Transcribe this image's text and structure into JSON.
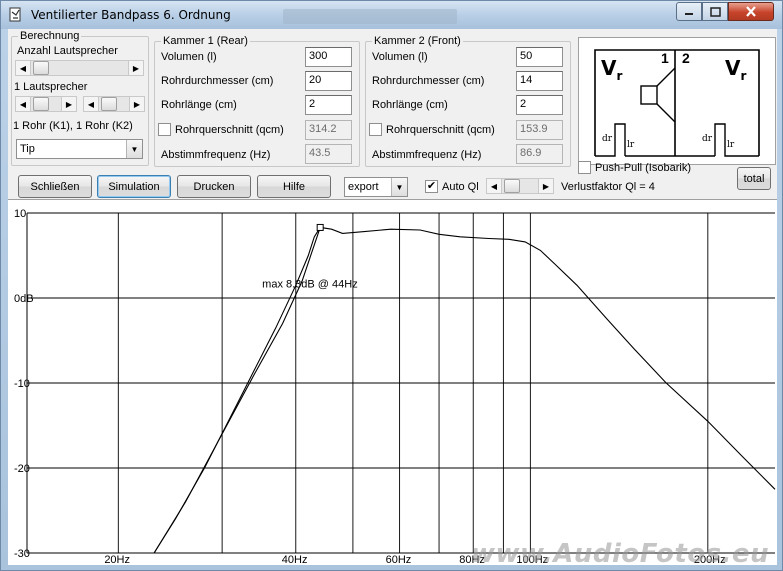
{
  "window": {
    "title": "Ventilierter Bandpass 6. Ordnung"
  },
  "berechnung": {
    "legend": "Berechnung",
    "anzahl_label": "Anzahl Lautsprecher",
    "lautsprecher_label": "1 Lautsprecher",
    "rohr_label": "1 Rohr (K1), 1 Rohr (K2)",
    "tip_value": "Tip"
  },
  "kammer1": {
    "legend": "Kammer 1 (Rear)",
    "volumen_label": "Volumen (l)",
    "volumen_value": "300",
    "rohrdurchmesser_label": "Rohrdurchmesser (cm)",
    "rohrdurchmesser_value": "20",
    "rohrlaenge_label": "Rohrlänge (cm)",
    "rohrlaenge_value": "2",
    "rohrquerschnitt_label": "Rohrquerschnitt (qcm)",
    "rohrquerschnitt_value": "314.2",
    "abstimm_label": "Abstimmfrequenz (Hz)",
    "abstimm_value": "43.5"
  },
  "kammer2": {
    "legend": "Kammer 2 (Front)",
    "volumen_label": "Volumen (l)",
    "volumen_value": "50",
    "rohrdurchmesser_label": "Rohrdurchmesser (cm)",
    "rohrdurchmesser_value": "14",
    "rohrlaenge_label": "Rohrlänge (cm)",
    "rohrlaenge_value": "2",
    "rohrquerschnitt_label": "Rohrquerschnitt (qcm)",
    "rohrquerschnitt_value": "153.9",
    "abstimm_label": "Abstimmfrequenz (Hz)",
    "abstimm_value": "86.9"
  },
  "diagram": {
    "vr_left": "V",
    "vr_right": "V",
    "sub": "r",
    "num1": "1",
    "num2": "2",
    "dr_left": "dr",
    "lr_left": "lr",
    "dr_right": "dr",
    "lr_right": "lr"
  },
  "pushpull_label": "Push-Pull (Isobarik)",
  "total_label": "total",
  "toolbar": {
    "schliessen": "Schließen",
    "simulation": "Simulation",
    "drucken": "Drucken",
    "hilfe": "Hilfe",
    "export_value": "export",
    "auto_ql_label": "Auto Ql",
    "verlust_label": "Verlustfaktor Ql = 4"
  },
  "watermark": "www.AudioFotos.eu",
  "chart_data": {
    "type": "line",
    "xscale": "log",
    "xlim": [
      14,
      260
    ],
    "ylim": [
      -30,
      10
    ],
    "x_ticks": [
      20,
      40,
      60,
      80,
      100,
      200
    ],
    "x_tick_labels": [
      "20Hz",
      "40Hz",
      "60Hz",
      "80Hz",
      "100Hz",
      "200Hz"
    ],
    "y_ticks": [
      10,
      0,
      -10,
      -20,
      -30
    ],
    "y_tick_labels": [
      "10",
      "0dB",
      "-10",
      "-20",
      "-30"
    ],
    "grid": true,
    "annotation": "max 8.3dB @ 44Hz",
    "peak": {
      "x": 44,
      "y": 8.3
    },
    "series": [
      {
        "color": "#000000",
        "points": [
          [
            23,
            -30
          ],
          [
            25,
            -26
          ],
          [
            28,
            -20
          ],
          [
            31,
            -14
          ],
          [
            34,
            -8.5
          ],
          [
            37,
            -3.5
          ],
          [
            40,
            1.5
          ],
          [
            42,
            5
          ],
          [
            43,
            7.2
          ],
          [
            44,
            8.3
          ],
          [
            46,
            8.1
          ],
          [
            48,
            7.6
          ],
          [
            52,
            7.8
          ],
          [
            58,
            8.1
          ],
          [
            65,
            8.0
          ],
          [
            70,
            7.5
          ],
          [
            76,
            7.2
          ],
          [
            85,
            7.0
          ],
          [
            92,
            6.9
          ],
          [
            98,
            6.6
          ],
          [
            104,
            5.6
          ],
          [
            110,
            4.0
          ],
          [
            120,
            1.5
          ],
          [
            135,
            -2.5
          ],
          [
            150,
            -6.0
          ],
          [
            170,
            -10.0
          ],
          [
            200,
            -14.5
          ],
          [
            230,
            -18.8
          ],
          [
            260,
            -22.5
          ]
        ]
      },
      {
        "color": "#000000",
        "points": [
          [
            23,
            -30
          ],
          [
            26,
            -24
          ],
          [
            30,
            -16
          ],
          [
            34,
            -9
          ],
          [
            38,
            -3
          ],
          [
            41,
            2
          ],
          [
            44,
            8.3
          ]
        ]
      }
    ]
  }
}
